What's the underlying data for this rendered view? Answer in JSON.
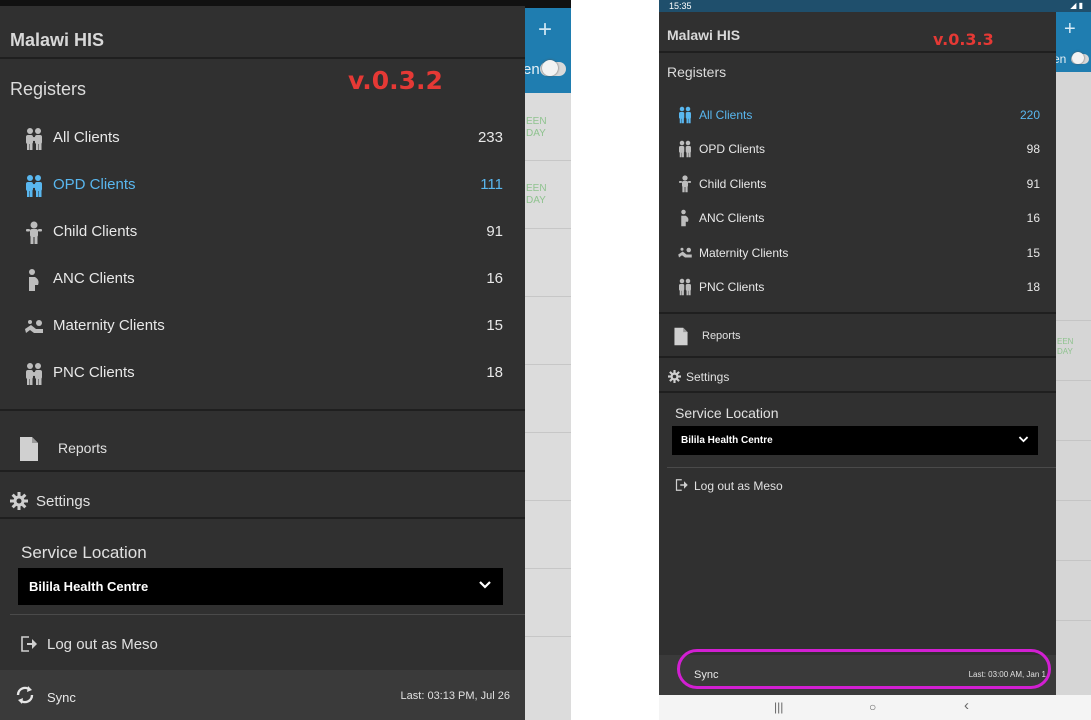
{
  "left": {
    "app_title": "Malawi HIS",
    "version": "v.0.3.2",
    "registers_label": "Registers",
    "items": [
      {
        "label": "All Clients",
        "count": "233",
        "icon": "family-icon"
      },
      {
        "label": "OPD Clients",
        "count": "111",
        "icon": "family-icon",
        "active": true
      },
      {
        "label": "Child Clients",
        "count": "91",
        "icon": "child-icon"
      },
      {
        "label": "ANC Clients",
        "count": "16",
        "icon": "pregnant-icon"
      },
      {
        "label": "Maternity Clients",
        "count": "15",
        "icon": "maternity-icon"
      },
      {
        "label": "PNC Clients",
        "count": "18",
        "icon": "family-icon"
      }
    ],
    "reports_label": "Reports",
    "settings_label": "Settings",
    "service_location_label": "Service Location",
    "service_location_value": "Bilila Health Centre",
    "logout_label": "Log out as Meso",
    "sync_label": "Sync",
    "last_sync": "Last: 03:13 PM, Jul 26",
    "background_status": [
      "EEN",
      "DAY"
    ]
  },
  "right": {
    "status_time": "15:35",
    "app_title": "Malawi HIS",
    "version": "v.0.3.3",
    "registers_label": "Registers",
    "items": [
      {
        "label": "All Clients",
        "count": "220",
        "icon": "family-icon",
        "active": true
      },
      {
        "label": "OPD Clients",
        "count": "98",
        "icon": "family-icon"
      },
      {
        "label": "Child Clients",
        "count": "91",
        "icon": "child-icon"
      },
      {
        "label": "ANC Clients",
        "count": "16",
        "icon": "pregnant-icon"
      },
      {
        "label": "Maternity Clients",
        "count": "15",
        "icon": "maternity-icon"
      },
      {
        "label": "PNC Clients",
        "count": "18",
        "icon": "family-icon"
      }
    ],
    "reports_label": "Reports",
    "settings_label": "Settings",
    "service_location_label": "Service Location",
    "service_location_value": "Bilila Health Centre",
    "logout_label": "Log out as Meso",
    "sync_label": "Sync",
    "last_sync": "Last: 03:00 AM, Jan 1",
    "background_toggle_text": "en",
    "nav": [
      "|||",
      "○",
      "‹"
    ]
  },
  "colors": {
    "drawer_bg": "#303030",
    "active": "#59b7ef",
    "version_red": "#e53935",
    "highlight_magenta": "#d21fd2",
    "app_bar_blue": "#1f7db0"
  }
}
